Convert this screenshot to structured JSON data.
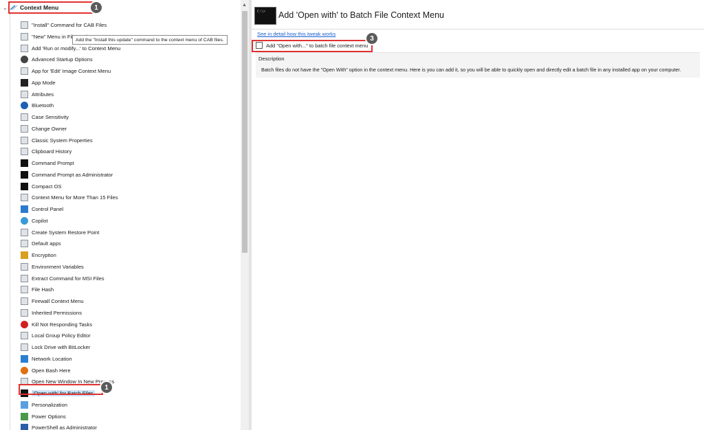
{
  "tree": {
    "root_label": "Context Menu",
    "items": [
      {
        "label": "\"Install\" Command for CAB Files",
        "icon": "cab-icon"
      },
      {
        "label": "\"New\" Menu in File Explorer",
        "icon": "new-menu-icon"
      },
      {
        "label": "Add 'Run or modify...' to Context Menu",
        "icon": "run-icon"
      },
      {
        "label": "Advanced Startup Options",
        "icon": "startup-icon"
      },
      {
        "label": "App for 'Edit' Image Context Menu",
        "icon": "edit-image-icon"
      },
      {
        "label": "App Mode",
        "icon": "app-mode-icon"
      },
      {
        "label": "Attributes",
        "icon": "attributes-icon"
      },
      {
        "label": "Bluetooth",
        "icon": "bluetooth-icon"
      },
      {
        "label": "Case Sensitivity",
        "icon": "case-icon"
      },
      {
        "label": "Change Owner",
        "icon": "owner-icon"
      },
      {
        "label": "Classic System Properties",
        "icon": "system-properties-icon"
      },
      {
        "label": "Clipboard History",
        "icon": "clipboard-icon"
      },
      {
        "label": "Command Prompt",
        "icon": "command-prompt-icon"
      },
      {
        "label": "Command Prompt as Administrator",
        "icon": "command-prompt-admin-icon"
      },
      {
        "label": "Compact OS",
        "icon": "compact-os-icon"
      },
      {
        "label": "Context Menu for More Than 15 Files",
        "icon": "context-menu-icon"
      },
      {
        "label": "Control Panel",
        "icon": "control-panel-icon"
      },
      {
        "label": "Copilot",
        "icon": "copilot-icon"
      },
      {
        "label": "Create System Restore Point",
        "icon": "restore-point-icon"
      },
      {
        "label": "Default apps",
        "icon": "default-apps-icon"
      },
      {
        "label": "Encryption",
        "icon": "lock-icon"
      },
      {
        "label": "Environment Variables",
        "icon": "env-vars-icon"
      },
      {
        "label": "Extract Command for MSI Files",
        "icon": "msi-icon"
      },
      {
        "label": "File Hash",
        "icon": "file-hash-icon"
      },
      {
        "label": "Firewall Context Menu",
        "icon": "firewall-icon"
      },
      {
        "label": "Inherited Permissions",
        "icon": "permissions-icon"
      },
      {
        "label": "Kill Not Responding Tasks",
        "icon": "kill-tasks-icon"
      },
      {
        "label": "Local Group Policy Editor",
        "icon": "group-policy-icon"
      },
      {
        "label": "Lock Drive with BitLocker",
        "icon": "bitlocker-icon"
      },
      {
        "label": "Network Location",
        "icon": "network-icon"
      },
      {
        "label": "Open Bash Here",
        "icon": "bash-icon"
      },
      {
        "label": "Open New Window In New Process",
        "icon": "new-window-icon"
      },
      {
        "label": "'Open with' for Batch Files",
        "icon": "batch-icon",
        "selected": true
      },
      {
        "label": "Personalization",
        "icon": "personalization-icon"
      },
      {
        "label": "Power Options",
        "icon": "power-options-icon"
      },
      {
        "label": "PowerShell as Administrator",
        "icon": "powershell-icon"
      }
    ]
  },
  "tooltip": "Add the \"Install this update\" command to the context menu of CAB files.",
  "detail": {
    "title": "Add 'Open with' to Batch File Context Menu",
    "link": "See in detail how this tweak works",
    "checkbox_label": "Add \"Open with...\" to batch file context menu",
    "checkbox_checked": false,
    "description_title": "Description",
    "description_text": "Batch files do not have the \"Open With\" option in the context menu. Here is you can add it, so you will be able to quickly open and directly edit a batch file in any installed app on your computer."
  },
  "badges": {
    "root": "1",
    "selected": "1",
    "checkbox": "3"
  },
  "colors": {
    "highlight": "#e03030",
    "badge": "#5b5b5b",
    "link": "#1a5fd1"
  }
}
